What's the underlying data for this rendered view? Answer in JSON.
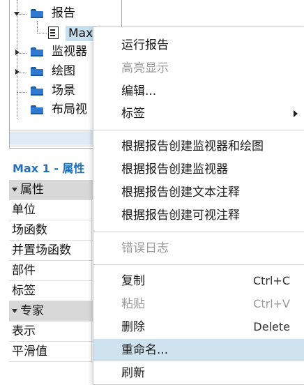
{
  "tree": {
    "items": [
      {
        "label": "报告",
        "expanded": true
      },
      {
        "label": "Max",
        "selected": true
      },
      {
        "label": "监视器",
        "expanded": false
      },
      {
        "label": "绘图",
        "expanded": false
      },
      {
        "label": "场景"
      },
      {
        "label": "布局视"
      }
    ]
  },
  "properties": {
    "title": "Max 1 - 属性",
    "rows": [
      {
        "label": "属性",
        "category": true
      },
      {
        "label": "单位"
      },
      {
        "label": "场函数"
      },
      {
        "label": "并置场函数"
      },
      {
        "label": "部件"
      },
      {
        "label": "标签"
      },
      {
        "label": "专家",
        "category": true
      },
      {
        "label": "表示"
      },
      {
        "label": "平滑值"
      }
    ]
  },
  "context_menu": {
    "items": [
      {
        "label": "运行报告",
        "shortcut": "",
        "disabled": false
      },
      {
        "label": "高亮显示",
        "shortcut": "",
        "disabled": true
      },
      {
        "label": "编辑...",
        "shortcut": "",
        "disabled": false
      },
      {
        "label": "标签",
        "shortcut": "",
        "disabled": false,
        "submenu": true
      },
      {
        "label": "根据报告创建监视器和绘图",
        "shortcut": "",
        "disabled": false
      },
      {
        "label": "根据报告创建监视器",
        "shortcut": "",
        "disabled": false
      },
      {
        "label": "根据报告创建文本注释",
        "shortcut": "",
        "disabled": false
      },
      {
        "label": "根据报告创建可视注释",
        "shortcut": "",
        "disabled": false
      },
      {
        "label": "错误日志",
        "shortcut": "",
        "disabled": true
      },
      {
        "label": "复制",
        "shortcut": "Ctrl+C",
        "disabled": false
      },
      {
        "label": "粘贴",
        "shortcut": "Ctrl+V",
        "disabled": true
      },
      {
        "label": "删除",
        "shortcut": "Delete",
        "disabled": false
      },
      {
        "label": "重命名...",
        "shortcut": "",
        "disabled": false,
        "hovered": true
      },
      {
        "label": "刷新",
        "shortcut": "",
        "disabled": false
      }
    ]
  },
  "colors": {
    "accent": "#2471b6",
    "folder": "#2f7ad0",
    "hover": "#cfe3ef",
    "disabled_text": "#9a9a9a"
  },
  "icons": {
    "folder": "folder-icon",
    "report": "report-document-icon",
    "submenu": "chevron-right-icon",
    "expand": "caret-down-icon",
    "collapse": "caret-right-icon"
  }
}
